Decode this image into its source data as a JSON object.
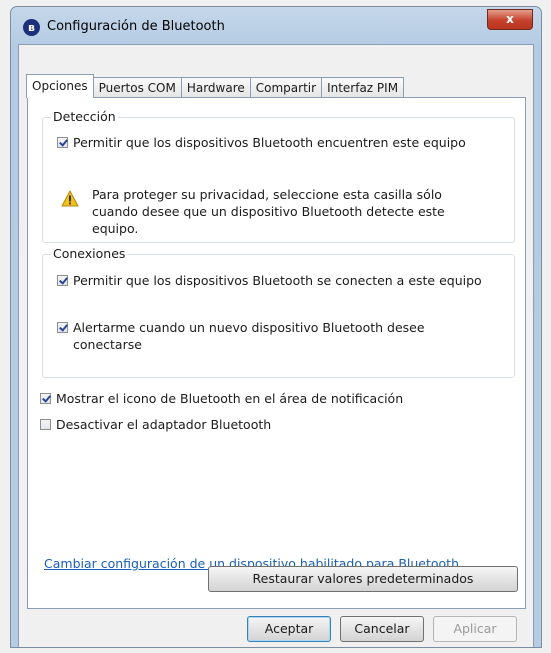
{
  "window": {
    "title": "Configuración de Bluetooth",
    "close_label": "x"
  },
  "tabs": [
    {
      "label": "Opciones",
      "active": true
    },
    {
      "label": "Puertos COM"
    },
    {
      "label": "Hardware"
    },
    {
      "label": "Compartir"
    },
    {
      "label": "Interfaz PIM"
    }
  ],
  "detection": {
    "title": "Detección",
    "allow_discovery": {
      "label": "Permitir que los dispositivos Bluetooth encuentren este equipo",
      "checked": true
    },
    "warning_text": "Para proteger su privacidad, seleccione esta casilla sólo cuando desee que un dispositivo Bluetooth detecte este equipo.",
    "warning_icon": "warning-icon"
  },
  "connections": {
    "title": "Conexiones",
    "allow_connect": {
      "label": "Permitir que los dispositivos Bluetooth se conecten a este equipo",
      "checked": true
    },
    "alert_new": {
      "label": "Alertarme cuando un nuevo dispositivo Bluetooth desee conectarse",
      "checked": true
    }
  },
  "options": {
    "show_icon": {
      "label": "Mostrar el icono de Bluetooth en el área de notificación",
      "checked": true
    },
    "disable_adapter": {
      "label": "Desactivar el adaptador Bluetooth",
      "checked": false
    }
  },
  "link_text": "Cambiar configuración de un dispositivo habilitado para Bluetooth.",
  "buttons": {
    "restore": "Restaurar valores predeterminados",
    "ok": "Aceptar",
    "cancel": "Cancelar",
    "apply": "Aplicar"
  },
  "colors": {
    "title_bar": "#b6cce3",
    "link": "#1a5fb4",
    "close_button": "#c6412b",
    "check_mark": "#2c4790",
    "warning": "#f2c21b"
  }
}
